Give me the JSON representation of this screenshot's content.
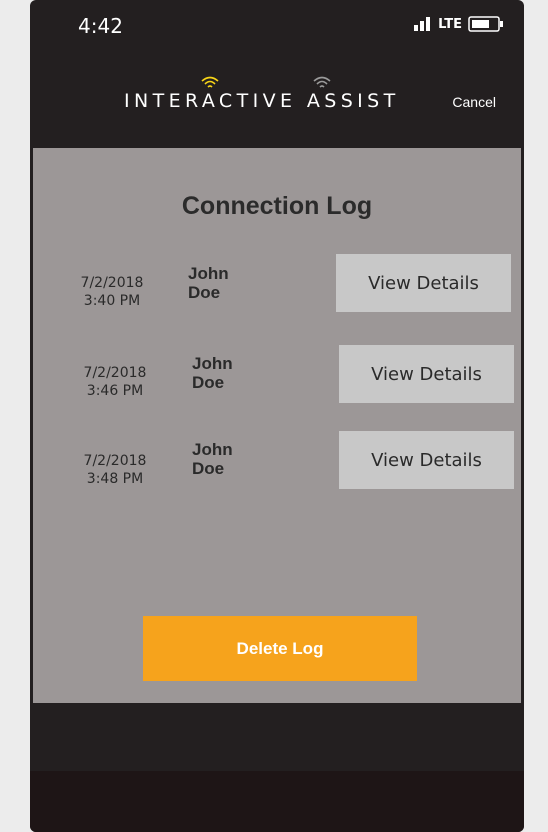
{
  "status_bar": {
    "time": "4:42",
    "carrier": "LTE",
    "signal_icon": "signal-icon",
    "battery_icon": "battery-icon"
  },
  "header": {
    "logo_text": "INTERACTIVE ASSIST",
    "cancel_label": "Cancel",
    "colors": {
      "logo_wifi_accent": "#f7d417",
      "logo_wifi_muted": "#9a9a9a"
    }
  },
  "main": {
    "title": "Connection Log",
    "entries": [
      {
        "date": "7/2/2018",
        "time": "3:40 PM",
        "first_name": "John",
        "last_name": "Doe",
        "button_label": "View Details"
      },
      {
        "date": "7/2/2018",
        "time": "3:46 PM",
        "first_name": "John",
        "last_name": "Doe",
        "button_label": "View Details"
      },
      {
        "date": "7/2/2018",
        "time": "3:48 PM",
        "first_name": "John",
        "last_name": "Doe",
        "button_label": "View Details"
      }
    ],
    "delete_label": "Delete Log"
  },
  "colors": {
    "frame": "#231f20",
    "content_bg": "#9c9797",
    "button_bg": "#c8c8c8",
    "delete_bg": "#f6a31c"
  }
}
